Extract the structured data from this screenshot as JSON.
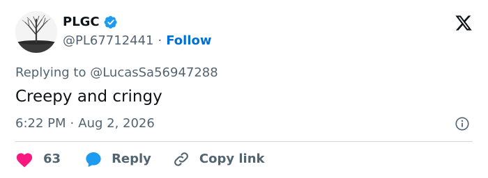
{
  "tweet": {
    "author": {
      "name": "PLGC",
      "handle": "@PL67712441",
      "verified_icon": "verified-badge-icon",
      "follow_label": "Follow",
      "separator": "·"
    },
    "replying_to": "Replying to @LucasSa56947288",
    "text": "Creepy and cringy",
    "time": "6:22 PM",
    "date": "Aug 2, 2026",
    "meta_separator": "·"
  },
  "actions": {
    "likes": "63",
    "reply_label": "Reply",
    "copy_link_label": "Copy link"
  },
  "icons": {
    "close": "x-logo-icon",
    "info": "info-icon",
    "like": "heart-icon",
    "reply": "speech-bubble-icon",
    "copy": "link-icon"
  },
  "colors": {
    "accent": "#006fd6",
    "verified": "#1d9bf0",
    "like": "#f91880",
    "reply": "#1d9bf0",
    "secondary_text": "#536471",
    "primary_text": "#0f1419",
    "divider": "#cfd9de"
  }
}
